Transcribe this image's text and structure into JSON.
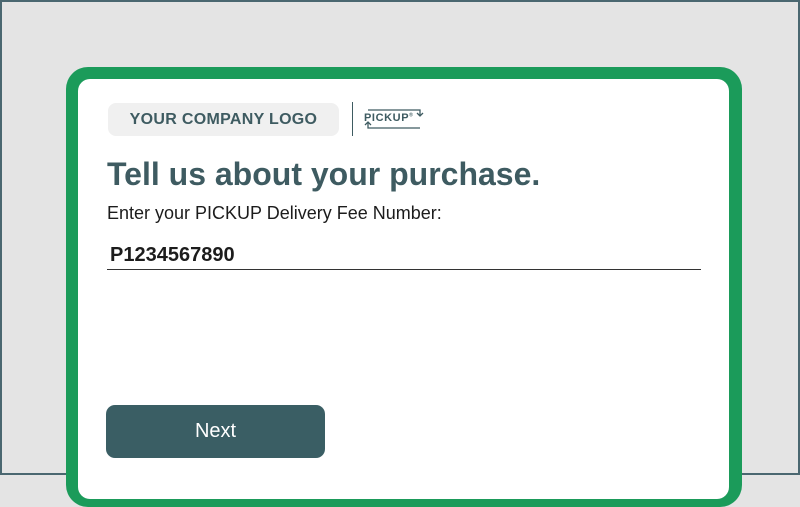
{
  "branding": {
    "company_logo_text": "YOUR COMPANY LOGO",
    "partner_logo_text": "PICKUP",
    "partner_logo_mark": "®"
  },
  "form": {
    "headline": "Tell us about your purchase.",
    "field_label": "Enter your PICKUP Delivery Fee Number:",
    "fee_number_value": "P1234567890",
    "next_label": "Next"
  },
  "colors": {
    "frame_green": "#1b9b5a",
    "primary_teal": "#3a5e64",
    "background_gray": "#e4e4e4"
  }
}
